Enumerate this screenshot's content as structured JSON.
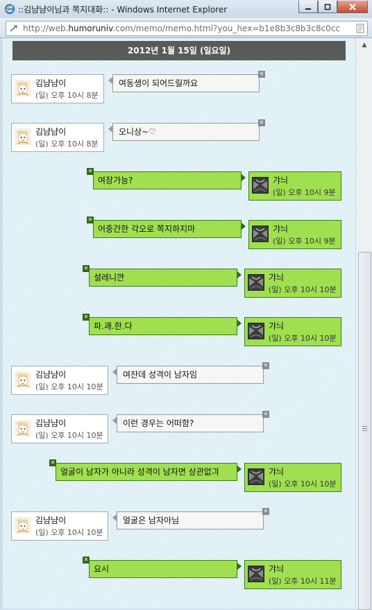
{
  "window": {
    "title": "::김냠냠이님과 쪽지대화:: - Windows Internet Explorer",
    "buttons": [
      "minimize",
      "maximize",
      "close"
    ]
  },
  "address_bar": {
    "url_prefix": "http://web.",
    "url_domain": "humoruniv",
    "url_suffix": ".com/memo/memo.html?you_hex=b1e8b3c8b3c8c0cc"
  },
  "date_header": "2012년 1월 15일 (일요일)",
  "colors": {
    "my_bubble": "#a0e050",
    "their_bubble": "#f6f6f6",
    "date_bar": "#5a5a5a",
    "background": "#e5f3f8"
  },
  "messages": [
    {
      "from": "them",
      "name": "김냠냠이",
      "time": "(일) 오후 10시 8분",
      "text": "여동생이 되어드릴까요"
    },
    {
      "from": "them",
      "name": "김냠냠이",
      "time": "(일) 오후 10시 8분",
      "text": "오니상~♡"
    },
    {
      "from": "me",
      "name": "갸늬",
      "time": "(일) 오후 10시 9분",
      "text": "여장가능?"
    },
    {
      "from": "me",
      "name": "갸늬",
      "time": "(일) 오후 10시 9분",
      "text": "어중간한 각오로 쪽지하지마"
    },
    {
      "from": "me",
      "name": "갸늬",
      "time": "(일) 오후 10시 10분",
      "text": "설레니깐"
    },
    {
      "from": "me",
      "name": "갸늬",
      "time": "(일) 오후 10시 10분",
      "text": "파.괘.한.다"
    },
    {
      "from": "them",
      "name": "김냠냠이",
      "time": "(일) 오후 10시 10분",
      "text": "여잔데 성격이 남자임"
    },
    {
      "from": "them",
      "name": "김냠냠이",
      "time": "(일) 오후 10시 10분",
      "text": "이런 경우는 어떠함?"
    },
    {
      "from": "me",
      "name": "갸늬",
      "time": "(일) 오후 10시 10분",
      "text": "얼굴이 남자가 아니라 성격이 남자면 상관없긔"
    },
    {
      "from": "them",
      "name": "김냠냠이",
      "time": "(일) 오후 10시 10분",
      "text": "얼굴은 남자아님"
    },
    {
      "from": "me",
      "name": "갸늬",
      "time": "(일) 오후 10시 11분",
      "text": "요시"
    }
  ],
  "icons": {
    "their_avatar": "cartoon-character-avatar-icon",
    "my_avatar": "dark-grayscale-avatar-icon",
    "delete": "close-x-icon"
  }
}
